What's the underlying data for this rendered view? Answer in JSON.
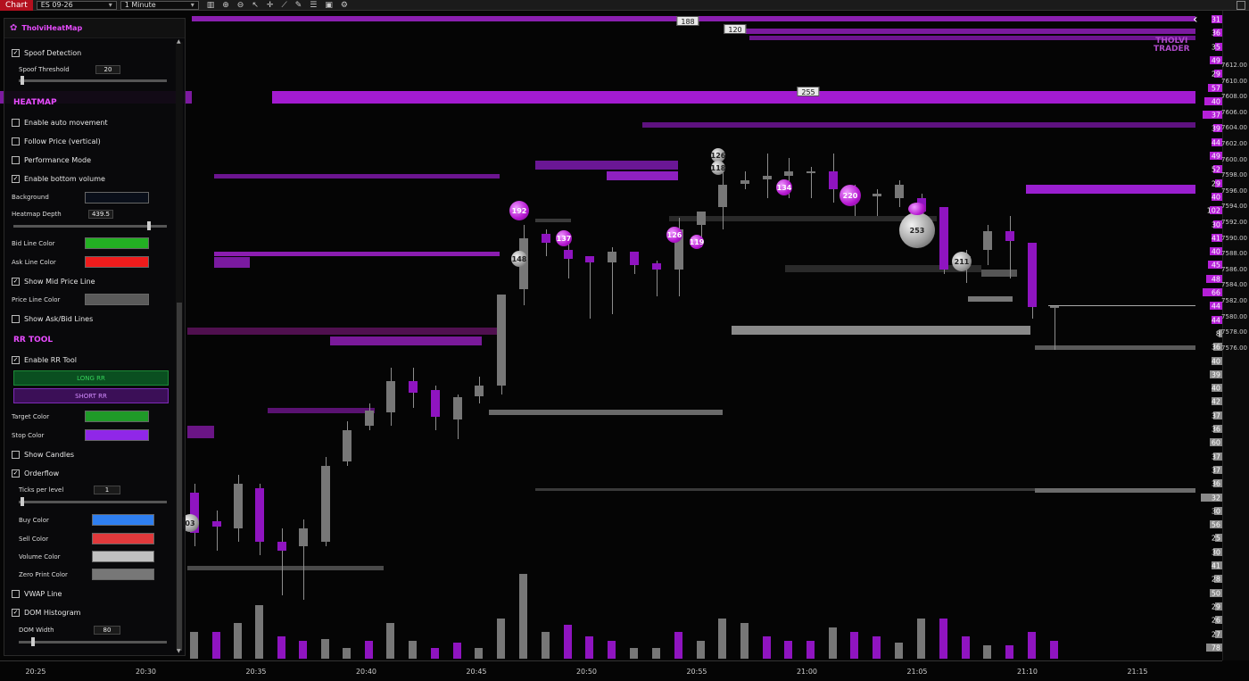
{
  "toolbar": {
    "tab": "Chart",
    "instrument": "ES 09-26",
    "interval": "1 Minute",
    "icons": [
      "bar-chart-icon",
      "magnify-plus-icon",
      "magnify-minus-icon",
      "pointer-icon",
      "crosshair-icon",
      "draw-line-icon",
      "drawing-tools-icon",
      "properties-icon",
      "screenshot-icon",
      "strategy-icon"
    ]
  },
  "panel": {
    "title": "TholviHeatMap",
    "items": {
      "spoof_detection": "Spoof Detection",
      "spoof_threshold_label": "Spoof Threshold",
      "spoof_threshold_value": "20",
      "heatmap_section": "HEATMAP",
      "auto_movement": "Enable auto movement",
      "follow_price": "Follow Price (vertical)",
      "performance_mode": "Performance Mode",
      "bottom_volume": "Enable bottom volume",
      "background_label": "Background",
      "heatmap_depth_label": "Heatmap Depth",
      "heatmap_depth_value": "439.5",
      "bid_line_color": "Bid Line Color",
      "ask_line_color": "Ask Line Color",
      "show_mid_price": "Show Mid Price Line",
      "price_line_color": "Price Line Color",
      "show_ask_bid": "Show Ask/Bid Lines",
      "rr_section": "RR TOOL",
      "enable_rr": "Enable RR Tool",
      "long_rr": "LONG RR",
      "short_rr": "SHORT RR",
      "target_color": "Target Color",
      "stop_color": "Stop Color",
      "show_candles": "Show Candles",
      "orderflow": "Orderflow",
      "ticks_per_level_label": "Ticks per level",
      "ticks_per_level_value": "1",
      "buy_color": "Buy Color",
      "sell_color": "Sell Color",
      "volume_color": "Volume Color",
      "zero_print_color": "Zero Print Color",
      "vwap_line": "VWAP Line",
      "dom_histogram": "DOM Histogram",
      "dom_width_label": "DOM Width",
      "dom_width_value": "80"
    },
    "colors": {
      "background": "#0a0f1a",
      "bid": "#23b023",
      "ask": "#ee1c1c",
      "price_line": "#5a5a5a",
      "target": "#1f9a28",
      "stop": "#9027e8",
      "buy": "#2f7ff0",
      "sell": "#e0393b",
      "volume": "#c0c0c0",
      "zero_print": "#777777"
    }
  },
  "price_axis": [
    "7612.00",
    "7610.00",
    "7608.00",
    "7606.00",
    "7604.00",
    "7602.00",
    "7600.00",
    "7598.00",
    "7596.00",
    "7594.00",
    "7592.00",
    "7590.00",
    "7588.00",
    "7586.00",
    "7584.00",
    "7582.00",
    "7580.00",
    "7578.00",
    "7576.00"
  ],
  "dom_sizes": [
    "31",
    "36",
    "35",
    "49",
    "29",
    "57",
    "40",
    "37",
    "39",
    "44",
    "49",
    "52",
    "29",
    "40",
    "102",
    "30",
    "41",
    "40",
    "45",
    "48",
    "66",
    "44",
    "44",
    "8",
    "36",
    "40",
    "39",
    "40",
    "42",
    "37",
    "36",
    "60",
    "37",
    "37",
    "36",
    "32",
    "30",
    "56",
    "25",
    "30",
    "41",
    "28",
    "50",
    "29",
    "26",
    "27",
    "78"
  ],
  "time_axis": [
    "20:25",
    "20:30",
    "20:35",
    "20:40",
    "20:45",
    "20:50",
    "20:55",
    "21:00",
    "21:05",
    "21:10",
    "21:15"
  ],
  "level_tags": [
    "188",
    "120",
    "255"
  ],
  "bubbles": [
    "192",
    "137",
    "126",
    "119",
    "126",
    "118",
    "134",
    "220",
    "253",
    "211",
    "148",
    "03"
  ],
  "watermark": {
    "line1": "THOLVI",
    "line2": "TRADER"
  }
}
